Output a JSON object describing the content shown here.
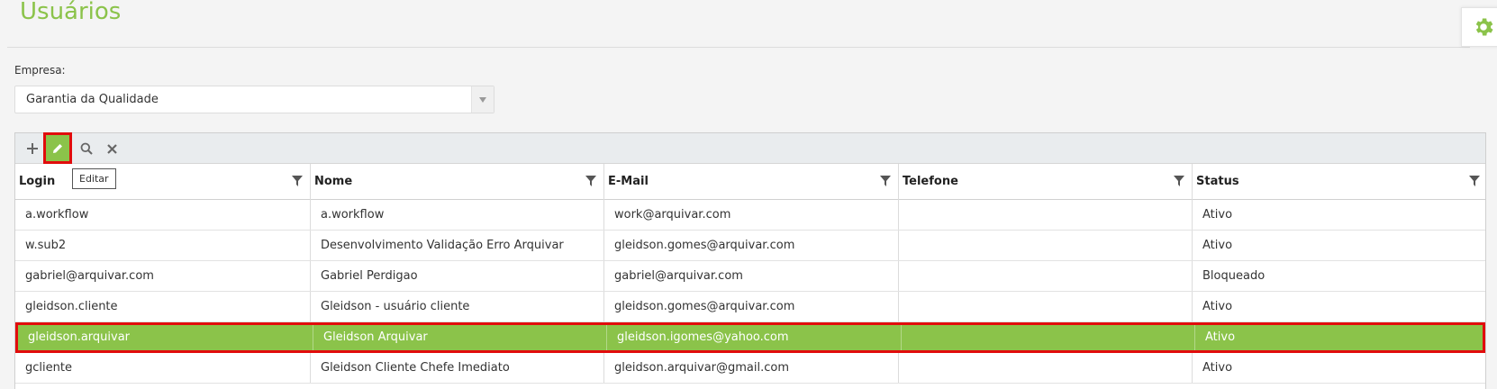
{
  "page": {
    "title": "Usuários"
  },
  "empresa": {
    "label": "Empresa:",
    "value": "Garantia da Qualidade"
  },
  "toolbar": {
    "tooltip": "Editar"
  },
  "columns": [
    "Login",
    "Nome",
    "E-Mail",
    "Telefone",
    "Status"
  ],
  "rows": [
    {
      "login": "a.workflow",
      "nome": "a.workflow",
      "email": "work@arquivar.com",
      "telefone": "",
      "status": "Ativo"
    },
    {
      "login": "w.sub2",
      "nome": "Desenvolvimento Validação Erro Arquivar",
      "email": "gleidson.gomes@arquivar.com",
      "telefone": "",
      "status": "Ativo"
    },
    {
      "login": "gabriel@arquivar.com",
      "nome": "Gabriel Perdigao",
      "email": "gabriel@arquivar.com",
      "telefone": "",
      "status": "Bloqueado"
    },
    {
      "login": "gleidson.cliente",
      "nome": "Gleidson - usuário cliente",
      "email": "gleidson.gomes@arquivar.com",
      "telefone": "",
      "status": "Ativo"
    },
    {
      "login": "gleidson.arquivar",
      "nome": "Gleidson Arquivar",
      "email": "gleidson.igomes@yahoo.com",
      "telefone": "",
      "status": "Ativo"
    },
    {
      "login": "gcliente",
      "nome": "Gleidson Cliente Chefe Imediato",
      "email": "gleidson.arquivar@gmail.com",
      "telefone": "",
      "status": "Ativo"
    }
  ],
  "icons": {
    "settings": "gear-icon",
    "add": "plus-icon",
    "edit": "pencil-icon",
    "search": "search-icon",
    "clear": "close-icon",
    "filter": "filter-icon",
    "dropdown": "chevron-down-icon"
  },
  "colors": {
    "accent": "#8bc34a",
    "highlight_border": "#e10c0c"
  }
}
